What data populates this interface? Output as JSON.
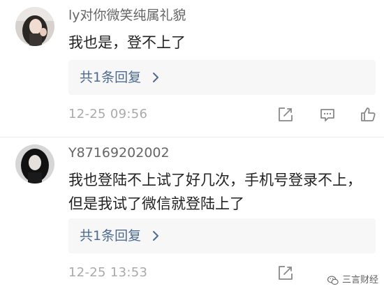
{
  "comments": [
    {
      "username": "ly对你微笑纯属礼貌",
      "content": "我也是，登不上了",
      "replies_label": "共1条回复",
      "timestamp": "12-25 09:56"
    },
    {
      "username": "Y87169202002",
      "content": "我也登陆不上试了好几次，手机号登录不上，但是我试了微信就登陆上了",
      "replies_label": "共1条回复",
      "timestamp": "12-25 13:53"
    }
  ],
  "icons": {
    "reply_chevron": "chevron-right-icon",
    "edit": "edit-share-icon",
    "comment": "comment-icon",
    "like": "thumbs-up-icon",
    "watermark": "wechat-logo-icon"
  },
  "watermark": {
    "text": "三言财经"
  },
  "colors": {
    "username": "#666666",
    "content": "#222222",
    "replies_link": "#4d6b8f",
    "replies_bg": "#f7f7f7",
    "timestamp": "#aaaaaa",
    "icon": "#888888"
  }
}
